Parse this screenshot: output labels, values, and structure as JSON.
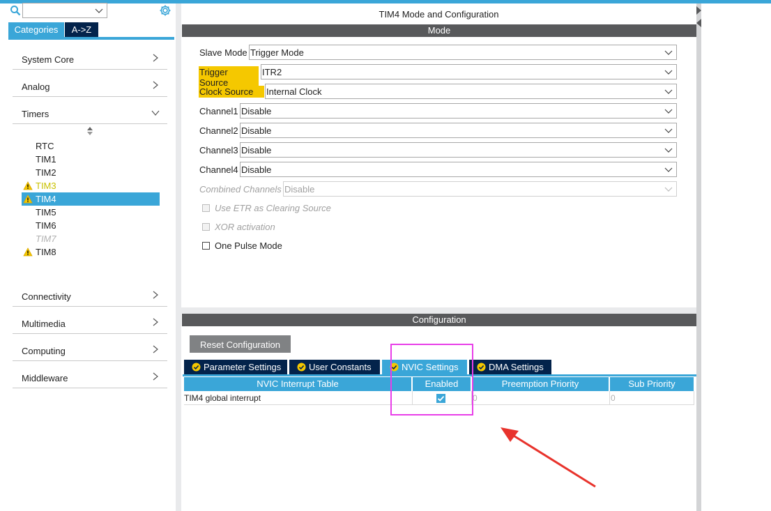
{
  "sidebar": {
    "search": {
      "value": ""
    },
    "tabs": {
      "categories": "Categories",
      "az": "A->Z"
    },
    "categories": [
      {
        "label": "System Core"
      },
      {
        "label": "Analog"
      },
      {
        "label": "Timers"
      },
      {
        "label": "Connectivity"
      },
      {
        "label": "Multimedia"
      },
      {
        "label": "Computing"
      },
      {
        "label": "Middleware"
      }
    ],
    "timers": [
      {
        "label": "RTC"
      },
      {
        "label": "TIM1"
      },
      {
        "label": "TIM2"
      },
      {
        "label": "TIM3",
        "warning": true
      },
      {
        "label": "TIM4",
        "warning": true,
        "selected": true
      },
      {
        "label": "TIM5"
      },
      {
        "label": "TIM6"
      },
      {
        "label": "TIM7",
        "disabled": true
      },
      {
        "label": "TIM8",
        "warning": true
      }
    ]
  },
  "main": {
    "title": "TIM4 Mode and Configuration",
    "mode_header": "Mode",
    "fields": [
      {
        "label": "Slave Mode",
        "value": "Trigger Mode"
      },
      {
        "label": "Trigger Source",
        "value": "ITR2",
        "highlight": true
      },
      {
        "label": "Clock Source",
        "value": "Internal Clock",
        "highlight": true
      },
      {
        "label": "Channel1",
        "value": "Disable"
      },
      {
        "label": "Channel2",
        "value": "Disable"
      },
      {
        "label": "Channel3",
        "value": "Disable"
      },
      {
        "label": "Channel4",
        "value": "Disable"
      },
      {
        "label": "Combined Channels",
        "value": "Disable",
        "disabled": true
      }
    ],
    "checkboxes": [
      {
        "label": "Use ETR as Clearing Source",
        "disabled": true,
        "checked": false
      },
      {
        "label": "XOR activation",
        "disabled": true,
        "checked": false
      },
      {
        "label": "One Pulse Mode",
        "disabled": false,
        "checked": false
      }
    ],
    "config_header": "Configuration",
    "reset_button": "Reset Configuration",
    "config_tabs": [
      {
        "label": "Parameter Settings"
      },
      {
        "label": "User Constants"
      },
      {
        "label": "NVIC Settings",
        "active": true
      },
      {
        "label": "DMA Settings"
      }
    ],
    "nvic_table": {
      "headers": [
        "NVIC Interrupt Table",
        "Enabled",
        "Preemption Priority",
        "Sub Priority"
      ],
      "rows": [
        {
          "name": "TIM4 global interrupt",
          "enabled": true,
          "preemption": "0",
          "sub": "0"
        }
      ]
    }
  },
  "colors": {
    "accent": "#3aa6d8",
    "navy": "#03234b",
    "header_gray": "#58595b",
    "highlight": "#f5c800",
    "annotation_box": "#e83ee8",
    "annotation_arrow": "#e8332c"
  }
}
